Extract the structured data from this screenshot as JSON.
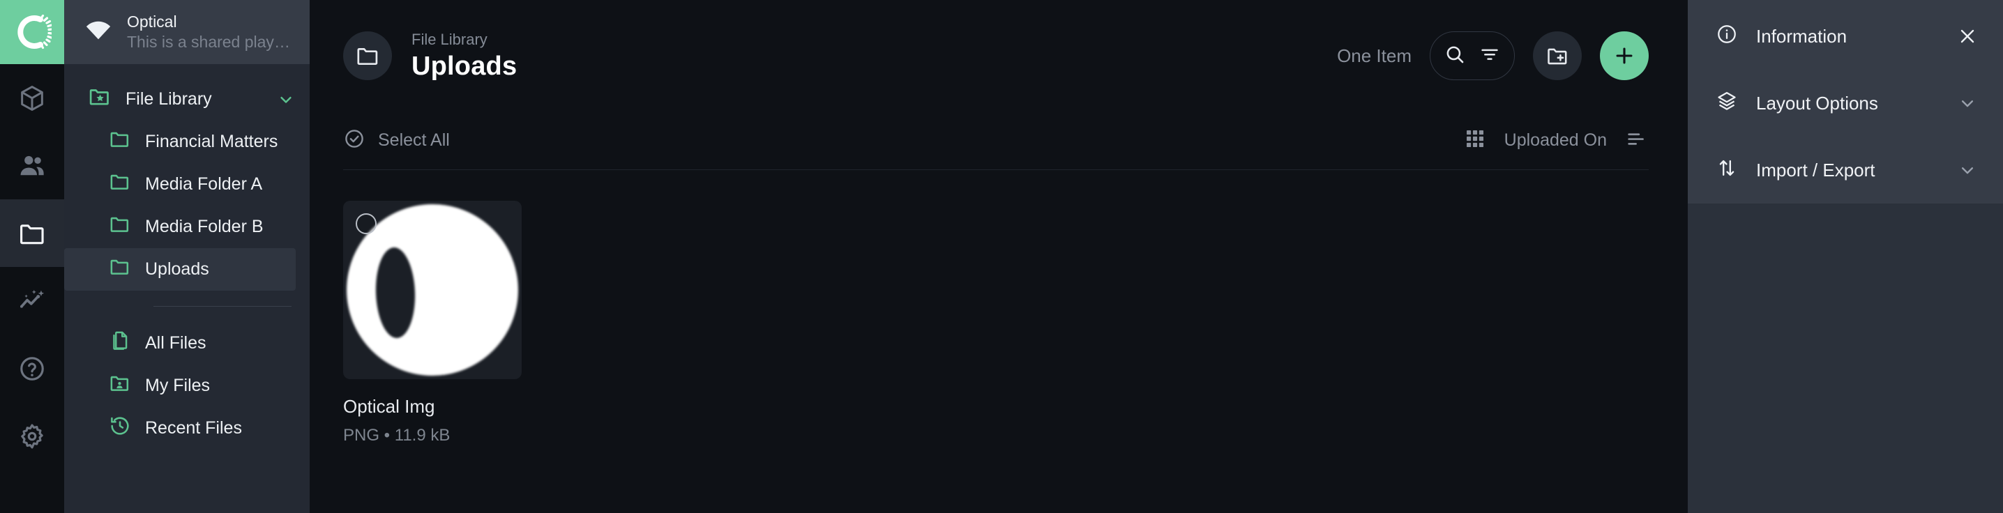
{
  "theme": {
    "accent": "#6ece9f",
    "panel_bg": "#363c47",
    "sidebar_bg": "#242933",
    "main_bg": "#0e1116",
    "rail_bg": "#0d1014"
  },
  "rail": {
    "logo_name": "app-logo",
    "items": [
      {
        "icon": "cube-icon",
        "name": "rail-item-models",
        "active": false
      },
      {
        "icon": "users-icon",
        "name": "rail-item-people",
        "active": false
      },
      {
        "icon": "folder-icon",
        "name": "rail-item-files",
        "active": true
      },
      {
        "icon": "sparkle-chart-icon",
        "name": "rail-item-insights",
        "active": false
      },
      {
        "icon": "help-circle-icon",
        "name": "rail-item-help",
        "active": false
      },
      {
        "icon": "gear-icon",
        "name": "rail-item-settings",
        "active": false
      }
    ]
  },
  "workspace": {
    "icon": "fan-icon",
    "title": "Optical",
    "subtitle": "This is a shared playgr..."
  },
  "tree": {
    "root": {
      "label": "File Library",
      "icon": "folder-star-icon",
      "chevron": "chevron-down-icon"
    },
    "children": [
      {
        "label": "Financial Matters",
        "icon": "folder-icon",
        "selected": false
      },
      {
        "label": "Media Folder A",
        "icon": "folder-icon",
        "selected": false
      },
      {
        "label": "Media Folder B",
        "icon": "folder-icon",
        "selected": false
      },
      {
        "label": "Uploads",
        "icon": "folder-icon",
        "selected": true
      }
    ],
    "links": [
      {
        "label": "All Files",
        "icon": "documents-icon"
      },
      {
        "label": "My Files",
        "icon": "folder-user-icon"
      },
      {
        "label": "Recent Files",
        "icon": "clock-history-icon"
      }
    ]
  },
  "header": {
    "breadcrumb": "File Library",
    "title": "Uploads",
    "folder_icon": "folder-icon",
    "item_count": "One Item",
    "search_icon": "search-icon",
    "filter_icon": "filter-icon",
    "new_folder_icon": "folder-plus-icon",
    "add_icon": "plus-icon"
  },
  "toolbar": {
    "select_all_label": "Select All",
    "select_all_icon": "check-circle-icon",
    "grid_view_icon": "grid-view-icon",
    "sort_label": "Uploaded On",
    "sort_icon": "sort-descending-icon"
  },
  "files": [
    {
      "name": "Optical Img",
      "meta": "PNG • 11.9 kB",
      "thumbnail": "white-circle-lens-image",
      "selected": false
    }
  ],
  "panel": {
    "rows": [
      {
        "label": "Information",
        "icon": "info-circle-icon",
        "trailing": "close-icon"
      },
      {
        "label": "Layout Options",
        "icon": "layers-icon",
        "trailing": "chevron-down-icon"
      },
      {
        "label": "Import / Export",
        "icon": "arrows-up-down-icon",
        "trailing": "chevron-down-icon"
      }
    ]
  }
}
